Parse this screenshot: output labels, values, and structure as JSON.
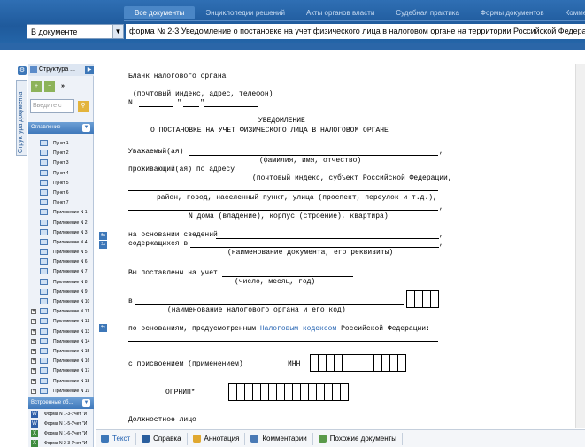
{
  "header": {
    "nav": [
      "Все документы",
      "Энциклопедии решений",
      "Акты органов власти",
      "Судебная практика",
      "Формы документов",
      "Коммен"
    ],
    "scope_select": "В документе",
    "doc_title": "форма № 2-3 Уведомление о постановке на учет физического лица в налоговом органе на территории Российской Федера"
  },
  "sidebar": {
    "vertical_tab": "Структура документа",
    "panel_title": "Структура ...",
    "more": "»",
    "search_placeholder": "Введите с",
    "toc_header": "Оглавление",
    "toc_items": [
      "Пункт 1",
      "Пункт 2",
      "Пункт 3",
      "Пункт 4",
      "Пункт 5",
      "Пункт 6",
      "Пункт 7",
      "Приложение N 1",
      "Приложение N 2",
      "Приложение N 3",
      "Приложение N 4",
      "Приложение N 5",
      "Приложение N 6",
      "Приложение N 7",
      "Приложение N 8",
      "Приложение N 9",
      "Приложение N 10",
      "Приложение N 11",
      "Приложение N 12",
      "Приложение N 13",
      "Приложение N 14",
      "Приложение N 15",
      "Приложение N 16",
      "Приложение N 17",
      "Приложение N 18",
      "Приложение N 19"
    ],
    "embedded_header": "Встроенные об...",
    "embedded_items": [
      "Форма N 1-3-Учет \"И",
      "Форма N 1-5-Учет \"И",
      "Форма N 1-6-Учет \"И",
      "Форма N 2-3-Учет \"И"
    ]
  },
  "document": {
    "l1": "Бланк налогового органа",
    "l2": "(почтовый индекс, адрес, телефон)",
    "l3a": "N",
    "l3b": "\"",
    "l3c": "\"",
    "title1": "УВЕДОМЛЕНИЕ",
    "title2": "О ПОСТАНОВКЕ НА УЧЕТ ФИЗИЧЕСКОГО ЛИЦА В НАЛОГОВОМ ОРГАНЕ",
    "dear": "Уважаемый(ая)",
    "comma": ",",
    "fio": "(фамилия, имя, отчество)",
    "living": "проживающий(ая) по адресу",
    "addr1": "(почтовый индекс, субъект Российской Федерации,",
    "addr2": "район, город, населенный пункт, улица (проспект, переулок и т.д.),",
    "addr3": "N дома (владение), корпус (строение), квартира)",
    "basis1": "на основании сведений",
    "basis2": "содержащихся в",
    "docname": "(наименование документа, его реквизиты)",
    "registered": "Вы поставлены на учет",
    "date": "(число, месяц, год)",
    "in": "в",
    "orgname": "(наименование налогового органа и его код)",
    "grounds_pre": "по основаниям, предусмотренным",
    "grounds_link": "Налоговым кодексом",
    "grounds_post": "Российской Федерации:",
    "assign": "с присвоением (применением)",
    "inn": "ИНН",
    "ogrnip": "ОГРНИП*",
    "official": "Должностное лицо"
  },
  "bottom_tabs": [
    "Текст",
    "Справка",
    "Аннотация",
    "Комментарии",
    "Похожие документы"
  ]
}
